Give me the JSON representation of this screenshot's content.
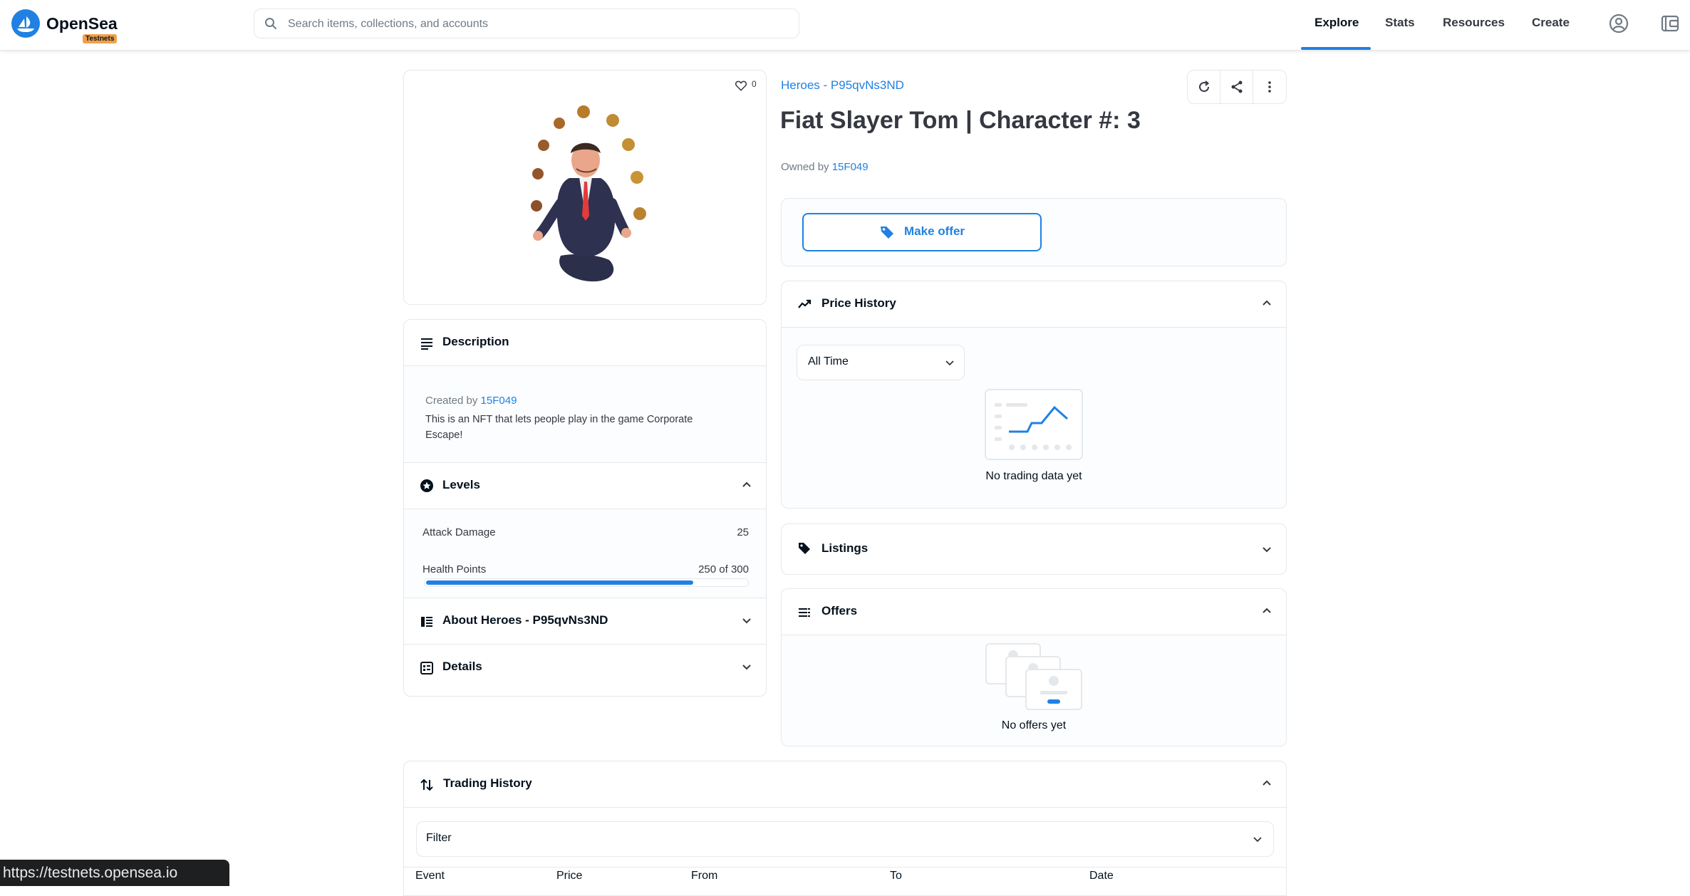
{
  "nav": {
    "logo": "OpenSea",
    "badge": "Testnets",
    "search_placeholder": "Search items, collections, and accounts",
    "links": [
      "Explore",
      "Stats",
      "Resources",
      "Create"
    ]
  },
  "item": {
    "collection": "Heroes - P95qvNs3ND",
    "title": "Fiat Slayer Tom | Character #: 3",
    "owned_by_label": "Owned by",
    "owner": "15F049",
    "favorites": "0"
  },
  "offer_button": "Make offer",
  "description": {
    "title": "Description",
    "created_by_label": "Created by",
    "creator": "15F049",
    "text": "This is an NFT that lets people play in the game Corporate Escape!"
  },
  "levels": {
    "title": "Levels",
    "rows": [
      {
        "label": "Attack Damage",
        "value": "25"
      },
      {
        "label": "Health Points",
        "value": "250 of 300",
        "fraction": 0.833
      }
    ]
  },
  "about": {
    "title": "About Heroes - P95qvNs3ND"
  },
  "details": {
    "title": "Details"
  },
  "price_history": {
    "title": "Price History",
    "range": "All Time",
    "empty": "No trading data yet"
  },
  "listings": {
    "title": "Listings"
  },
  "offers": {
    "title": "Offers",
    "empty": "No offers yet"
  },
  "trading_history": {
    "title": "Trading History",
    "filter": "Filter",
    "columns": [
      "Event",
      "Price",
      "From",
      "To",
      "Date"
    ]
  },
  "status_url": "https://testnets.opensea.io",
  "colors": {
    "accent": "#2081e2",
    "text": "#04111d",
    "border": "#e5e8eb"
  }
}
